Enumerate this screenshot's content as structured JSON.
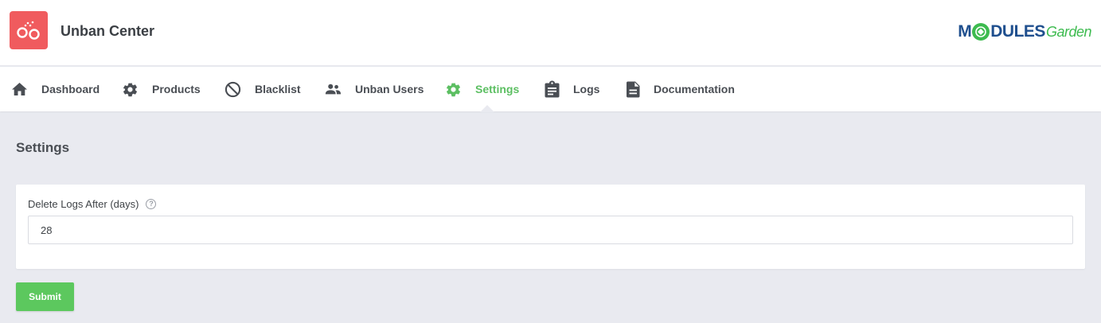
{
  "header": {
    "app_title": "Unban Center",
    "app_icon": "handcuffs-icon",
    "brand": {
      "strong": "M",
      "strong_rest": "DULES",
      "light": "Garden"
    }
  },
  "nav": {
    "items": [
      {
        "label": "Dashboard",
        "icon": "home-icon"
      },
      {
        "label": "Products",
        "icon": "gear-icon"
      },
      {
        "label": "Blacklist",
        "icon": "block-icon"
      },
      {
        "label": "Unban Users",
        "icon": "users-icon"
      },
      {
        "label": "Settings",
        "icon": "gear-icon",
        "active": true
      },
      {
        "label": "Logs",
        "icon": "clipboard-icon"
      },
      {
        "label": "Documentation",
        "icon": "document-icon"
      }
    ]
  },
  "page": {
    "title": "Settings"
  },
  "form": {
    "delete_logs_label": "Delete Logs After (days)",
    "delete_logs_value": "28",
    "help_glyph": "?",
    "submit_label": "Submit"
  },
  "colors": {
    "accent": "#5cbf62",
    "app_icon_bg": "#f05b5e",
    "brand_blue": "#1f4f8e",
    "brand_green": "#3dbb4f",
    "page_bg": "#e9eaf0"
  }
}
